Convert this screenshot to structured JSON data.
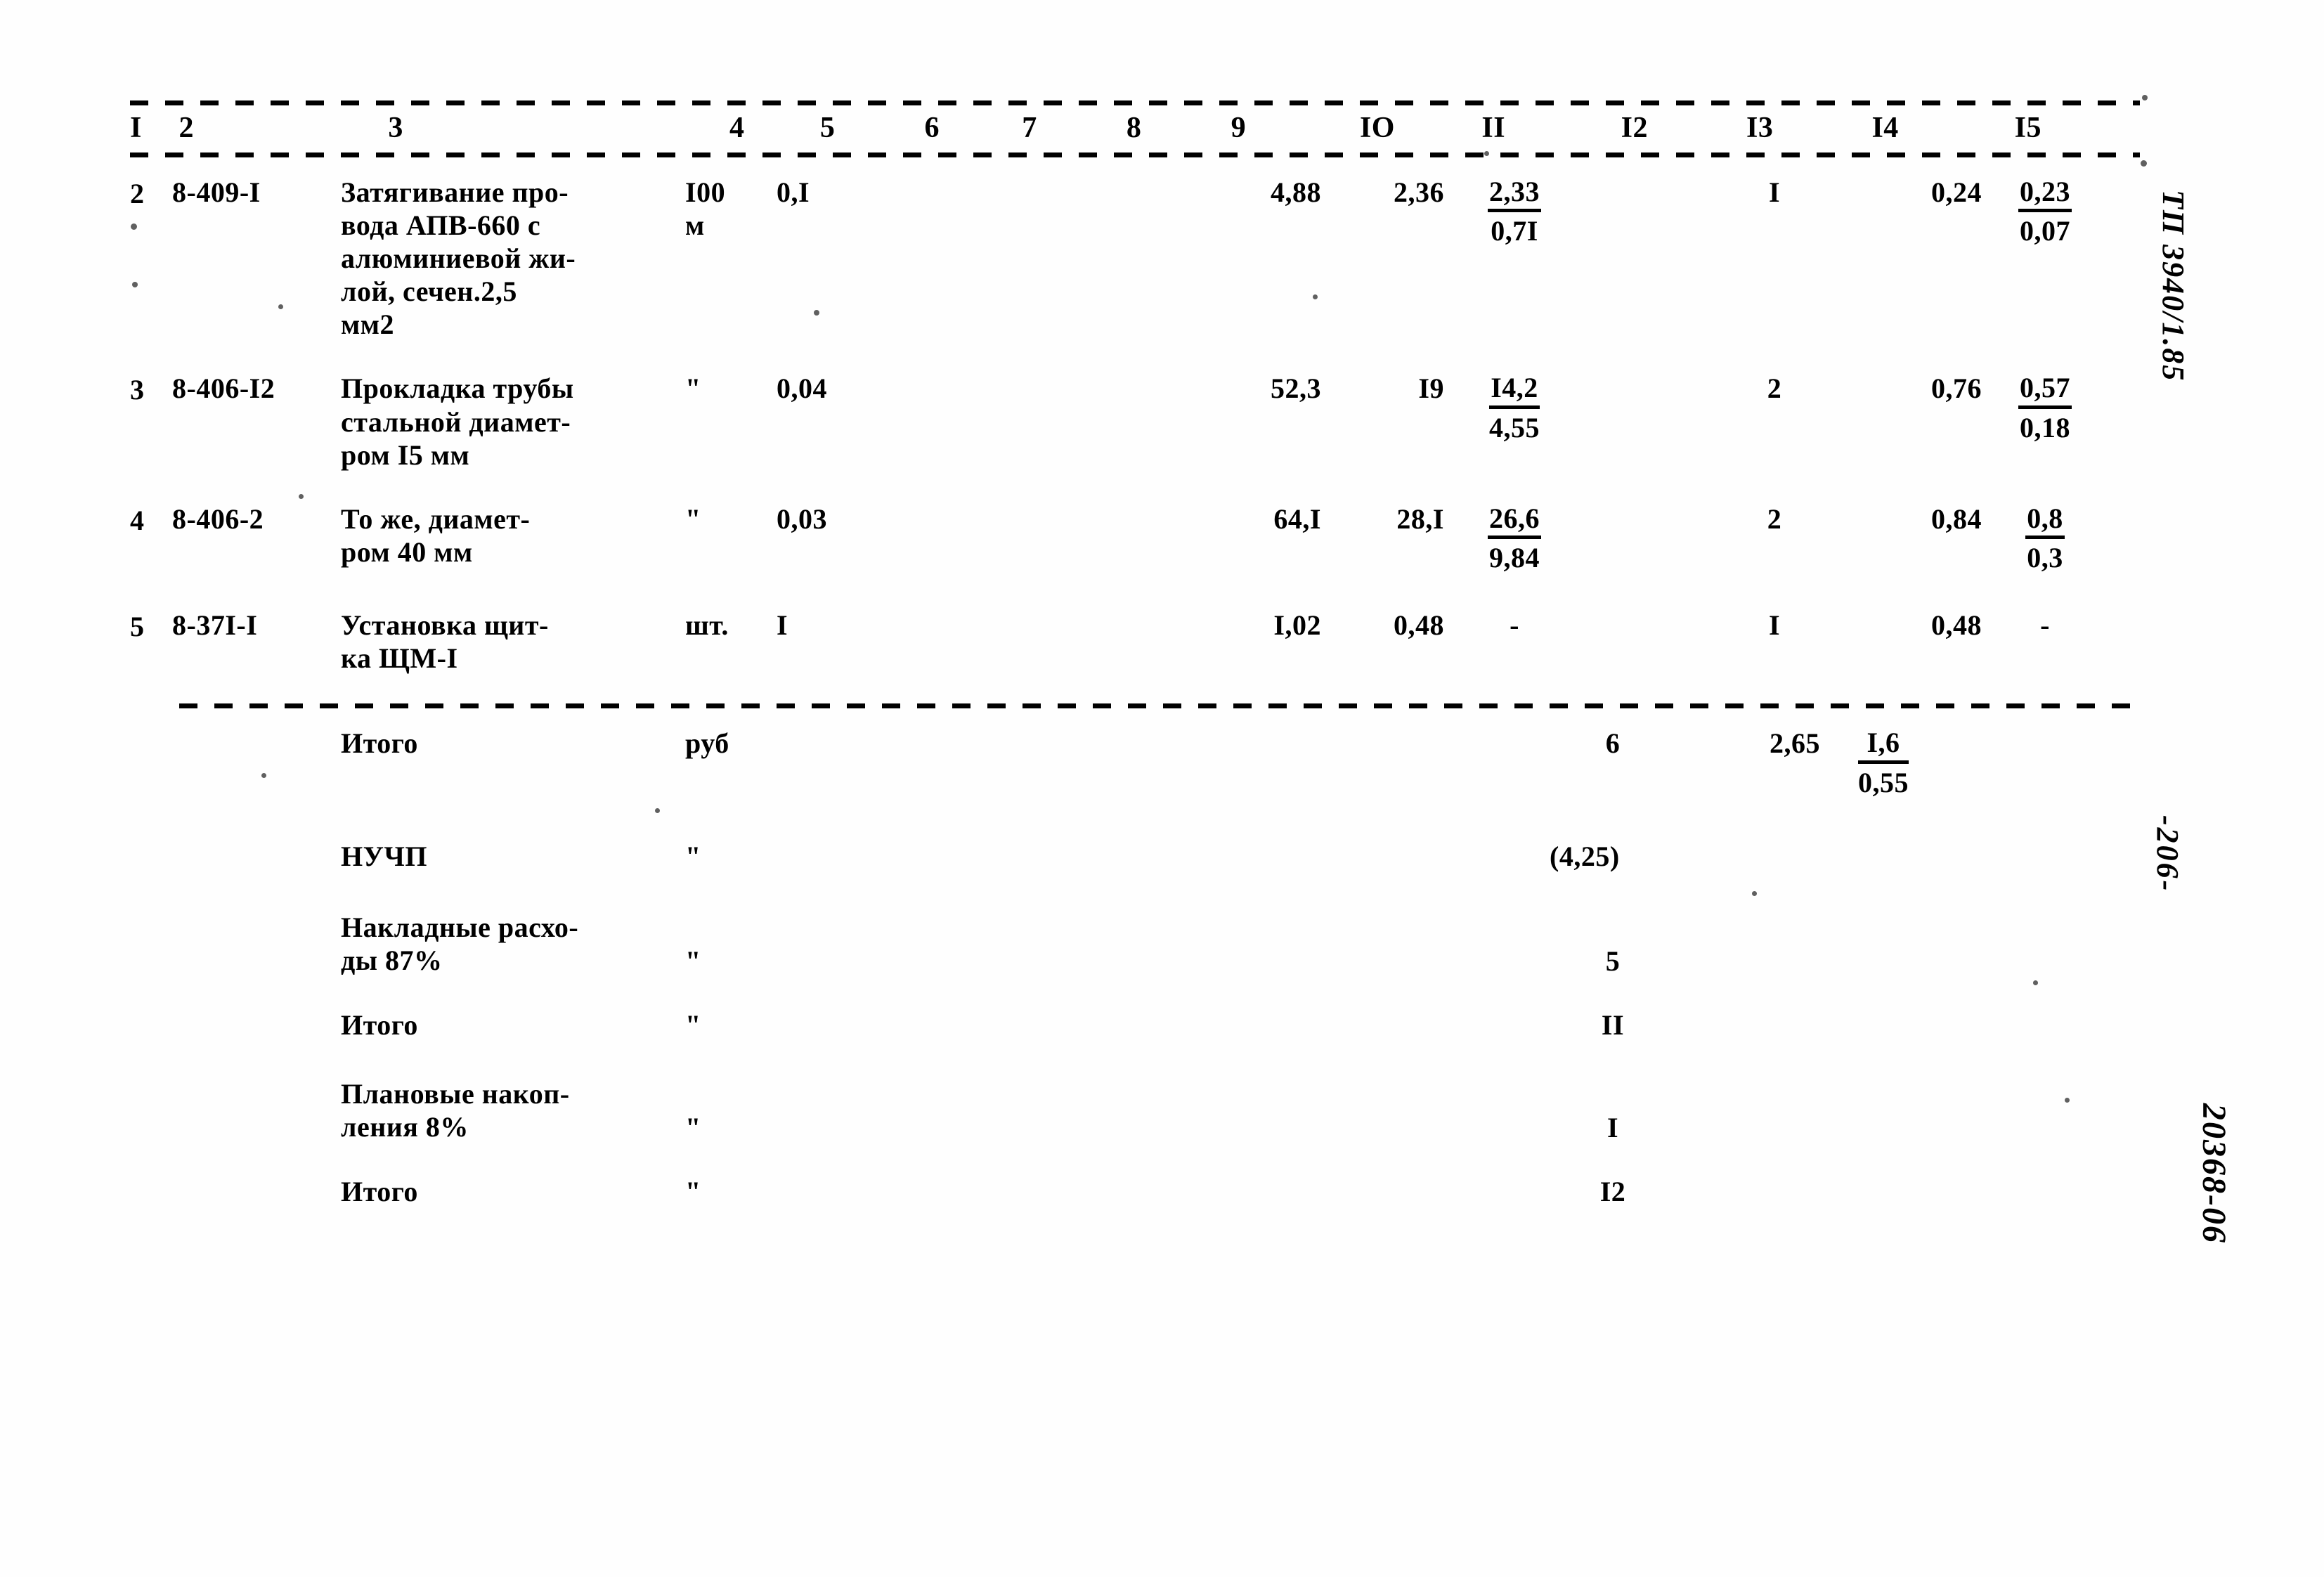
{
  "document": {
    "type": "construction-cost-estimate-table",
    "column_headers": [
      "I",
      "2",
      "3",
      "4",
      "5",
      "6",
      "7",
      "8",
      "9",
      "IO",
      "II",
      "I2",
      "I3",
      "I4",
      "I5"
    ]
  },
  "rows": [
    {
      "c1": "2",
      "c2": "8-409-I",
      "c3": "Затягивание про-\nвода АПВ-660 с\nалюминиевой жи-\nлой, сечен.2,5\nмм2",
      "c4": "I00\nм",
      "c5": "0,I",
      "c6": "",
      "c7": "",
      "c8": "",
      "c9": "4,88",
      "c10": "2,36",
      "c11_num": "2,33",
      "c11_den": "0,7I",
      "c12": "",
      "c13": "I",
      "c14": "0,24",
      "c15_num": "0,23",
      "c15_den": "0,07"
    },
    {
      "c1": "3",
      "c2": "8-406-I2",
      "c3": "Прокладка трубы\nстальной диамет-\nром I5 мм",
      "c4": "\"",
      "c5": "0,04",
      "c6": "",
      "c7": "",
      "c8": "",
      "c9": "52,3",
      "c10": "I9",
      "c11_num": "I4,2",
      "c11_den": "4,55",
      "c12": "",
      "c13": "2",
      "c14": "0,76",
      "c15_num": "0,57",
      "c15_den": "0,18"
    },
    {
      "c1": "4",
      "c2": "8-406-2",
      "c3": "То же, диамет-\nром 40 мм",
      "c4": "\"",
      "c5": "0,03",
      "c6": "",
      "c7": "",
      "c8": "",
      "c9": "64,I",
      "c10": "28,I",
      "c11_num": "26,6",
      "c11_den": "9,84",
      "c12": "",
      "c13": "2",
      "c14": "0,84",
      "c15_num": "0,8",
      "c15_den": "0,3"
    },
    {
      "c1": "5",
      "c2": "8-37I-I",
      "c3": "Установка щит-\nка ЩМ-I",
      "c4": "шт.",
      "c5": "I",
      "c6": "",
      "c7": "",
      "c8": "",
      "c9": "I,02",
      "c10": "0,48",
      "c11_num": "",
      "c11_den": "",
      "c11_plain": "-",
      "c12": "",
      "c13": "I",
      "c14": "0,48",
      "c15_num": "",
      "c15_den": "",
      "c15_plain": "-"
    }
  ],
  "summary": [
    {
      "label": "Итого",
      "unit": "руб",
      "c13": "6",
      "c14": "2,65",
      "c15_num": "I,6",
      "c15_den": "0,55"
    },
    {
      "label": "НУЧП",
      "unit": "\"",
      "c13": "(4,25)",
      "c14": "",
      "c15_num": "",
      "c15_den": ""
    },
    {
      "label": "Накладные расхо-\nды 87%",
      "unit": "\"",
      "c13": "5",
      "c14": "",
      "c15_num": "",
      "c15_den": ""
    },
    {
      "label": "Итого",
      "unit": "\"",
      "c13": "II",
      "c14": "",
      "c15_num": "",
      "c15_den": ""
    },
    {
      "label": "Плановые накоп-\nления 8%",
      "unit": "\"",
      "c13": "I",
      "c14": "",
      "c15_num": "",
      "c15_den": ""
    },
    {
      "label": "Итого",
      "unit": "\"",
      "c13": "I2",
      "c14": "",
      "c15_num": "",
      "c15_den": ""
    }
  ],
  "margin_notes": {
    "stamp_top": "ТП 3940/1.85",
    "page_number": "-206-",
    "doc_code": "20368-06"
  }
}
